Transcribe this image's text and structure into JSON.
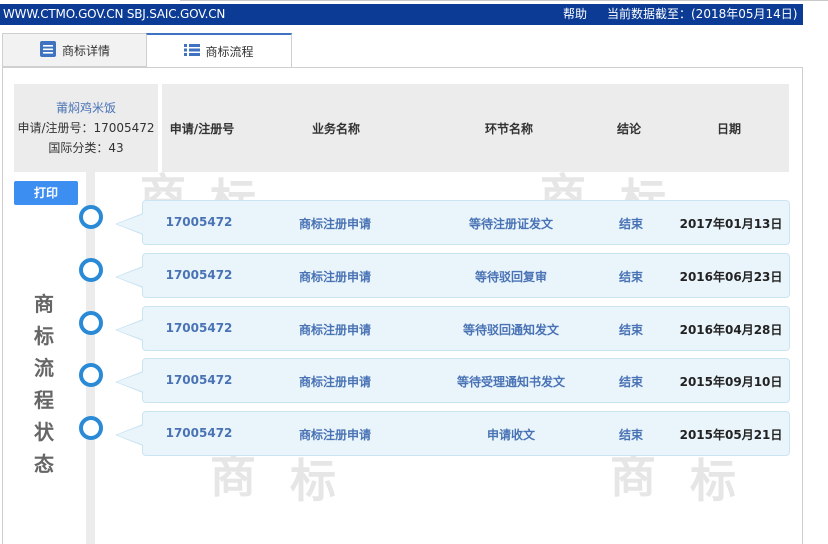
{
  "topbar": {
    "site": "WWW.CTMO.GOV.CN SBJ.SAIC.GOV.CN",
    "help": "帮助",
    "asof": "当前数据截至：(2018年05月14日)"
  },
  "tabs": [
    {
      "label": "商标详情",
      "icon": "document-icon"
    },
    {
      "label": "商标流程",
      "icon": "list-icon"
    }
  ],
  "info": {
    "name": "莆焖鸡米饭",
    "reg_no": "申请/注册号：17005472",
    "intl_class": "国际分类：43"
  },
  "columns": [
    "申请/注册号",
    "业务名称",
    "环节名称",
    "结论",
    "日期"
  ],
  "print_label": "打印",
  "side_title": [
    "商",
    "标",
    "流",
    "程",
    "状",
    "态"
  ],
  "rows": [
    {
      "reg": "17005472",
      "business": "商标注册申请",
      "step": "等待注册证发文",
      "result": "结束",
      "date": "2017年01月13日"
    },
    {
      "reg": "17005472",
      "business": "商标注册申请",
      "step": "等待驳回复审",
      "result": "结束",
      "date": "2016年06月23日"
    },
    {
      "reg": "17005472",
      "business": "商标注册申请",
      "step": "等待驳回通知发文",
      "result": "结束",
      "date": "2016年04月28日"
    },
    {
      "reg": "17005472",
      "business": "商标注册申请",
      "step": "等待受理通知书发文",
      "result": "结束",
      "date": "2015年09月10日"
    },
    {
      "reg": "17005472",
      "business": "商标注册申请",
      "step": "申请收文",
      "result": "结束",
      "date": "2015年05月21日"
    }
  ]
}
